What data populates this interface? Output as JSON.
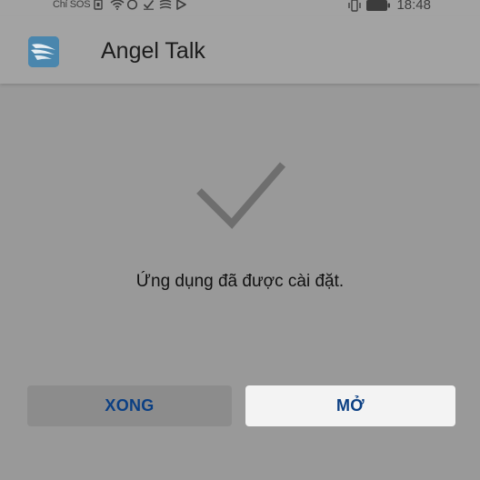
{
  "status_bar": {
    "carrier": "Chỉ SOS",
    "time": "18:48",
    "left_icons": [
      "sim-icon",
      "wifi-icon",
      "circle-icon",
      "check-icon",
      "data-saver-icon",
      "play-store-icon"
    ],
    "right_icons": [
      "vibrate-icon",
      "battery-icon"
    ]
  },
  "app_bar": {
    "title": "Angel Talk",
    "icon": "angel-talk-app-icon"
  },
  "main": {
    "status_icon": "checkmark-icon",
    "message": "Ứng dụng đã được cài đặt."
  },
  "actions": {
    "done_label": "XONG",
    "open_label": "MỞ"
  },
  "colors": {
    "background": "#999999",
    "bar": "#a3a3a3",
    "button_text": "#0b3f83",
    "open_button_bg": "#f3f3f3",
    "done_button_bg": "#8c8c8c",
    "checkmark": "#6e6e6e"
  }
}
